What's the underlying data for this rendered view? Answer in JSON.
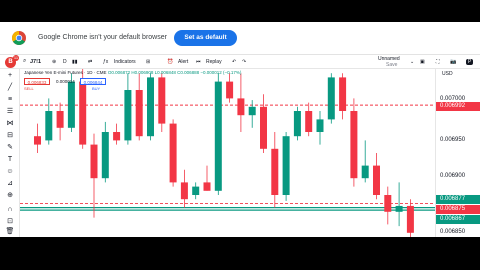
{
  "infobar": {
    "message": "Google Chrome isn't your default browser",
    "button_label": "Set as default"
  },
  "toolbar": {
    "avatar_badge": "11",
    "symbol": "J7!1",
    "indicators_label": "Indicators",
    "alert_label": "Alert",
    "replay_label": "Replay",
    "unnamed_label": "Unnamed",
    "save_label": "Save",
    "fx": "fx"
  },
  "legend": {
    "title": "Japanese Yen E-mini Futures · 1D · CME",
    "ohlc": "O0.006872 H0.006908 L0.006848 C0.006888 −0.000012 (−0.17%)",
    "sell_price": "0.006833",
    "sell_label": "SELL",
    "spread": "0.000014",
    "buy_price": "0.006844",
    "buy_label": "BUY"
  },
  "price_scale": {
    "currency": "USD",
    "ticks": [
      "0.007000",
      "0.006950",
      "0.006900",
      "0.006850"
    ],
    "tags": [
      {
        "value": "0.006992",
        "color": "#f23645"
      },
      {
        "value": "0.006877",
        "color": "#089981"
      },
      {
        "value": "0.006875",
        "color": "#f23645"
      },
      {
        "value": "0.006867",
        "color": "#089981"
      }
    ]
  },
  "chart_data": {
    "type": "candlestick",
    "ylim": [
      0.006835,
      0.007035
    ],
    "horizontal_lines": [
      {
        "value": 0.006992,
        "style": "dashed",
        "color": "#f23645"
      },
      {
        "value": 0.006875,
        "style": "dashed",
        "color": "#f23645"
      },
      {
        "value": 0.00687,
        "style": "solid",
        "color": "#089981"
      },
      {
        "value": 0.006867,
        "style": "solid",
        "color": "#089981"
      }
    ],
    "candles": [
      {
        "o": 0.006955,
        "h": 0.00697,
        "l": 0.006935,
        "c": 0.006945
      },
      {
        "o": 0.00695,
        "h": 0.007,
        "l": 0.006945,
        "c": 0.006985
      },
      {
        "o": 0.006985,
        "h": 0.006995,
        "l": 0.00695,
        "c": 0.006965
      },
      {
        "o": 0.006965,
        "h": 0.00703,
        "l": 0.00696,
        "c": 0.00702
      },
      {
        "o": 0.00702,
        "h": 0.007035,
        "l": 0.00694,
        "c": 0.006945
      },
      {
        "o": 0.006945,
        "h": 0.006958,
        "l": 0.006858,
        "c": 0.006905
      },
      {
        "o": 0.006905,
        "h": 0.006972,
        "l": 0.0069,
        "c": 0.00696
      },
      {
        "o": 0.00696,
        "h": 0.00697,
        "l": 0.006945,
        "c": 0.00695
      },
      {
        "o": 0.00695,
        "h": 0.00703,
        "l": 0.006945,
        "c": 0.00701
      },
      {
        "o": 0.00701,
        "h": 0.00703,
        "l": 0.00695,
        "c": 0.006955
      },
      {
        "o": 0.006955,
        "h": 0.00703,
        "l": 0.00695,
        "c": 0.007025
      },
      {
        "o": 0.007025,
        "h": 0.00703,
        "l": 0.00696,
        "c": 0.00697
      },
      {
        "o": 0.00697,
        "h": 0.006975,
        "l": 0.006895,
        "c": 0.0069
      },
      {
        "o": 0.0069,
        "h": 0.006915,
        "l": 0.00687,
        "c": 0.00688
      },
      {
        "o": 0.006885,
        "h": 0.0069,
        "l": 0.00688,
        "c": 0.006895
      },
      {
        "o": 0.0069,
        "h": 0.00692,
        "l": 0.00689,
        "c": 0.00689
      },
      {
        "o": 0.00689,
        "h": 0.00703,
        "l": 0.006885,
        "c": 0.00702
      },
      {
        "o": 0.00702,
        "h": 0.00703,
        "l": 0.006995,
        "c": 0.007
      },
      {
        "o": 0.007,
        "h": 0.00703,
        "l": 0.00696,
        "c": 0.00698
      },
      {
        "o": 0.00698,
        "h": 0.006998,
        "l": 0.006965,
        "c": 0.00699
      },
      {
        "o": 0.00699,
        "h": 0.007005,
        "l": 0.006935,
        "c": 0.00694
      },
      {
        "o": 0.00694,
        "h": 0.00696,
        "l": 0.00687,
        "c": 0.006885
      },
      {
        "o": 0.006885,
        "h": 0.00696,
        "l": 0.006878,
        "c": 0.006955
      },
      {
        "o": 0.006955,
        "h": 0.00699,
        "l": 0.00695,
        "c": 0.006985
      },
      {
        "o": 0.006985,
        "h": 0.006995,
        "l": 0.006955,
        "c": 0.00696
      },
      {
        "o": 0.00696,
        "h": 0.006985,
        "l": 0.006945,
        "c": 0.006975
      },
      {
        "o": 0.006975,
        "h": 0.00703,
        "l": 0.00697,
        "c": 0.007025
      },
      {
        "o": 0.007025,
        "h": 0.00703,
        "l": 0.006975,
        "c": 0.006985
      },
      {
        "o": 0.006985,
        "h": 0.007,
        "l": 0.006895,
        "c": 0.006905
      },
      {
        "o": 0.006905,
        "h": 0.00695,
        "l": 0.0069,
        "c": 0.00692
      },
      {
        "o": 0.00692,
        "h": 0.006935,
        "l": 0.00688,
        "c": 0.006885
      },
      {
        "o": 0.006885,
        "h": 0.006895,
        "l": 0.00685,
        "c": 0.006865
      },
      {
        "o": 0.006865,
        "h": 0.0069,
        "l": 0.006848,
        "c": 0.006872
      },
      {
        "o": 0.006872,
        "h": 0.00688,
        "l": 0.006835,
        "c": 0.00684
      }
    ]
  }
}
